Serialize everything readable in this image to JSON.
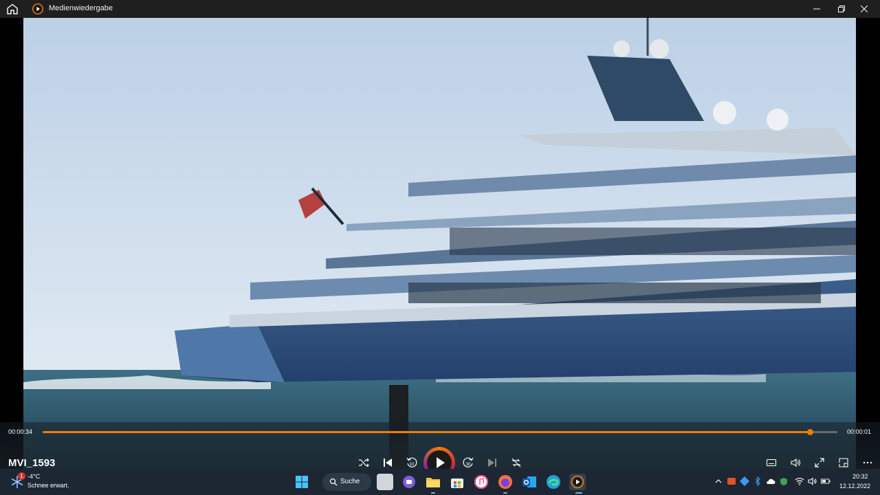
{
  "window": {
    "title": "Medienwiedergabe",
    "minimize_icon": "minimize-icon",
    "maximize_icon": "maximize-icon",
    "close_icon": "close-icon"
  },
  "player": {
    "current_time": "00:00:34",
    "remaining_time": "00:00:01",
    "progress_fraction": 0.965,
    "file_name": "MVI_1593",
    "accent_color": "#f57c00",
    "controls": [
      "shuffle-icon",
      "previous-icon",
      "rewind-10-icon",
      "play-icon",
      "forward-30-icon",
      "next-icon",
      "repeat-off-icon"
    ],
    "right_controls": [
      "subtitles-icon",
      "volume-icon",
      "fullscreen-icon",
      "mini-player-icon",
      "more-icon"
    ]
  },
  "taskbar": {
    "weather": {
      "temp": "-4°C",
      "description": "Schnee erwart.",
      "badge": "1"
    },
    "search_label": "Suche",
    "clock": {
      "time": "20:32",
      "date": "12.12.2022"
    }
  }
}
